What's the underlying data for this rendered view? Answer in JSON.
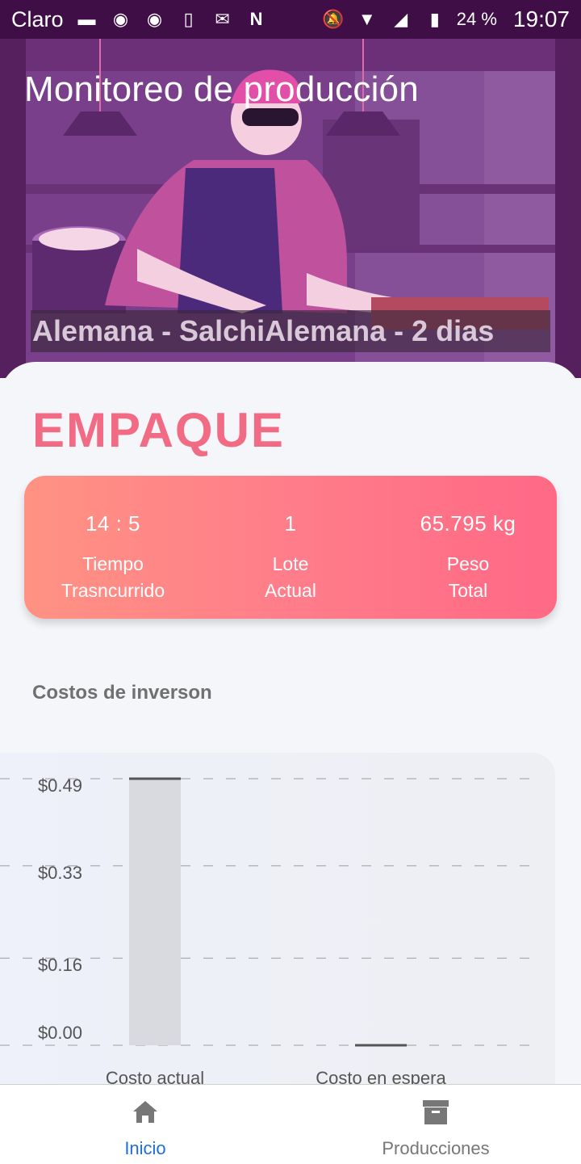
{
  "status_bar": {
    "carrier": "Claro",
    "battery": "24 %",
    "time": "19:07",
    "icons": [
      "message-icon",
      "messenger-icon",
      "messenger-icon",
      "vibrate-icon",
      "gmail-icon",
      "netflix-icon",
      "mute-icon",
      "wifi-icon",
      "signal-icon",
      "battery-charging-icon"
    ]
  },
  "hero": {
    "title": "Monitoreo de producción",
    "subtitle": "Alemana - SalchiAlemana - 2 dias"
  },
  "stage": {
    "title": "EMPAQUE"
  },
  "stats": [
    {
      "value": "14 : 5",
      "label_1": "Tiempo",
      "label_2": "Trasncurrido"
    },
    {
      "value": "1",
      "label_1": "Lote",
      "label_2": "Actual"
    },
    {
      "value": "65.795 kg",
      "label_1": "Peso",
      "label_2": "Total"
    }
  ],
  "costs_section": {
    "label": "Costos de inverson"
  },
  "chart_data": {
    "type": "bar",
    "categories": [
      "Costo actual",
      "Costo en espera"
    ],
    "values": [
      0.49,
      0.0
    ],
    "y_ticks": [
      "$0.49",
      "$0.33",
      "$0.16",
      "$0.00"
    ],
    "y_tick_values": [
      0.49,
      0.33,
      0.16,
      0.0
    ],
    "ylim": [
      0,
      0.49
    ],
    "grid": true,
    "bar_color": "#d8dadf",
    "title": "",
    "xlabel": "",
    "ylabel": ""
  },
  "bottom_nav": {
    "items": [
      {
        "label": "Inicio",
        "icon": "home-icon",
        "active": true
      },
      {
        "label": "Producciones",
        "icon": "archive-box-icon",
        "active": false
      }
    ]
  },
  "colors": {
    "accent": "#f26b85",
    "active_nav": "#1e6fd9",
    "status_bar": "#3f0e47"
  }
}
